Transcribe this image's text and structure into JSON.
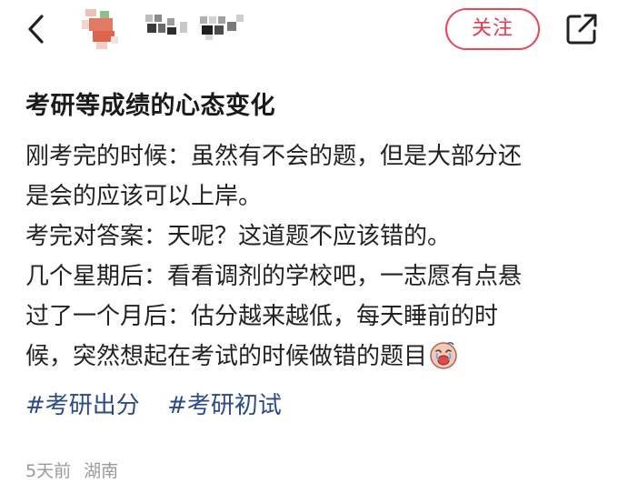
{
  "header": {
    "back_icon": "chevron-left-icon",
    "follow_label": "关注",
    "share_icon": "share-external-icon",
    "accent_color": "#e8485a"
  },
  "post": {
    "title": "考研等成绩的心态变化",
    "content_lines": [
      "刚考完的时候：虽然有不会的题，但是大部分还",
      "是会的应该可以上岸。",
      "考完对答案：天呢？这道题不应该错的。",
      "几个星期后：看看调剂的学校吧，一志愿有点悬",
      "过了一个月后：估分越来越低，每天睡前的时",
      "候，突然想起在考试的时候做错的题目"
    ],
    "emoji": "crying-face-emoji",
    "tags": [
      "#考研出分",
      "#考研初试"
    ],
    "time": "5天前",
    "location": "湖南"
  }
}
